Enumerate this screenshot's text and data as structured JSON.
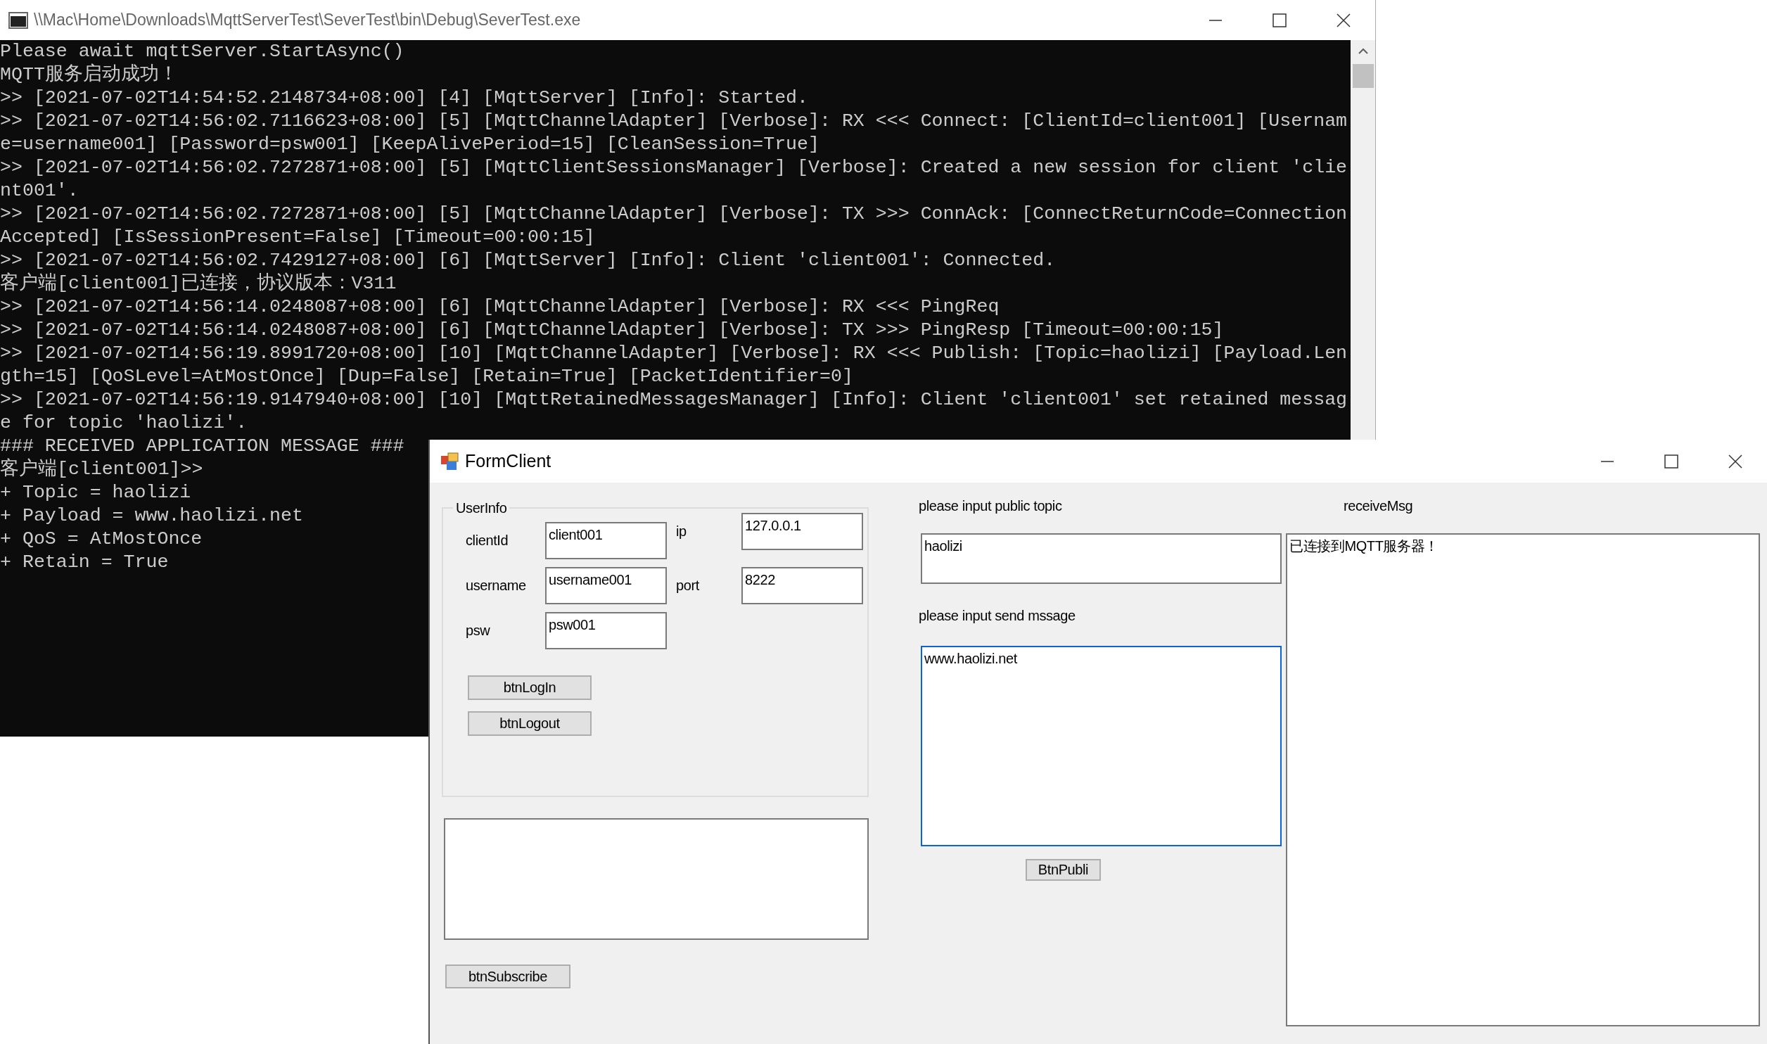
{
  "console_window": {
    "title": "\\\\Mac\\Home\\Downloads\\MqttServerTest\\SeverTest\\bin\\Debug\\SeverTest.exe",
    "lines": [
      "Please await mqttServer.StartAsync()",
      "MQTT服务启动成功！",
      ">> [2021-07-02T14:54:52.2148734+08:00] [4] [MqttServer] [Info]: Started.",
      ">> [2021-07-02T14:56:02.7116623+08:00] [5] [MqttChannelAdapter] [Verbose]: RX <<< Connect: [ClientId=client001] [Usernam",
      "e=username001] [Password=psw001] [KeepAlivePeriod=15] [CleanSession=True]",
      ">> [2021-07-02T14:56:02.7272871+08:00] [5] [MqttClientSessionsManager] [Verbose]: Created a new session for client 'clie",
      "nt001'.",
      ">> [2021-07-02T14:56:02.7272871+08:00] [5] [MqttChannelAdapter] [Verbose]: TX >>> ConnAck: [ConnectReturnCode=Connection",
      "Accepted] [IsSessionPresent=False] [Timeout=00:00:15]",
      ">> [2021-07-02T14:56:02.7429127+08:00] [6] [MqttServer] [Info]: Client 'client001': Connected.",
      "客户端[client001]已连接，协议版本：V311",
      ">> [2021-07-02T14:56:14.0248087+08:00] [6] [MqttChannelAdapter] [Verbose]: RX <<< PingReq",
      ">> [2021-07-02T14:56:14.0248087+08:00] [6] [MqttChannelAdapter] [Verbose]: TX >>> PingResp [Timeout=00:00:15]",
      ">> [2021-07-02T14:56:19.8991720+08:00] [10] [MqttChannelAdapter] [Verbose]: RX <<< Publish: [Topic=haolizi] [Payload.Len",
      "gth=15] [QoSLevel=AtMostOnce] [Dup=False] [Retain=True] [PacketIdentifier=0]",
      ">> [2021-07-02T14:56:19.9147940+08:00] [10] [MqttRetainedMessagesManager] [Info]: Client 'client001' set retained messag",
      "e for topic 'haolizi'.",
      "### RECEIVED APPLICATION MESSAGE ###",
      "客户端[client001]>>",
      "+ Topic = haolizi",
      "+ Payload = www.haolizi.net",
      "+ QoS = AtMostOnce",
      "+ Retain = True"
    ]
  },
  "form_window": {
    "title": "FormClient",
    "user_info": {
      "title": "UserInfo",
      "rows": [
        [
          {
            "label": "clientId",
            "value": "client001"
          },
          {
            "label": "ip",
            "value": "127.0.0.1"
          }
        ],
        [
          {
            "label": "username",
            "value": "username001"
          },
          {
            "label": "port",
            "value": "8222"
          }
        ],
        [
          {
            "label": "psw",
            "value": "psw001"
          }
        ]
      ],
      "buttons": [
        "btnLogIn",
        "btnLogout"
      ]
    },
    "subscribe_button": "btnSubscribe",
    "topic": {
      "label": "please input public topic",
      "value": "haolizi",
      "focused": false
    },
    "message": {
      "label": "please input send mssage",
      "value": "www.haolizi.net",
      "focused": true
    },
    "publish_button": "BtnPubli",
    "receive": {
      "label": "receiveMsg",
      "value": "已连接到MQTT服务器！"
    }
  }
}
